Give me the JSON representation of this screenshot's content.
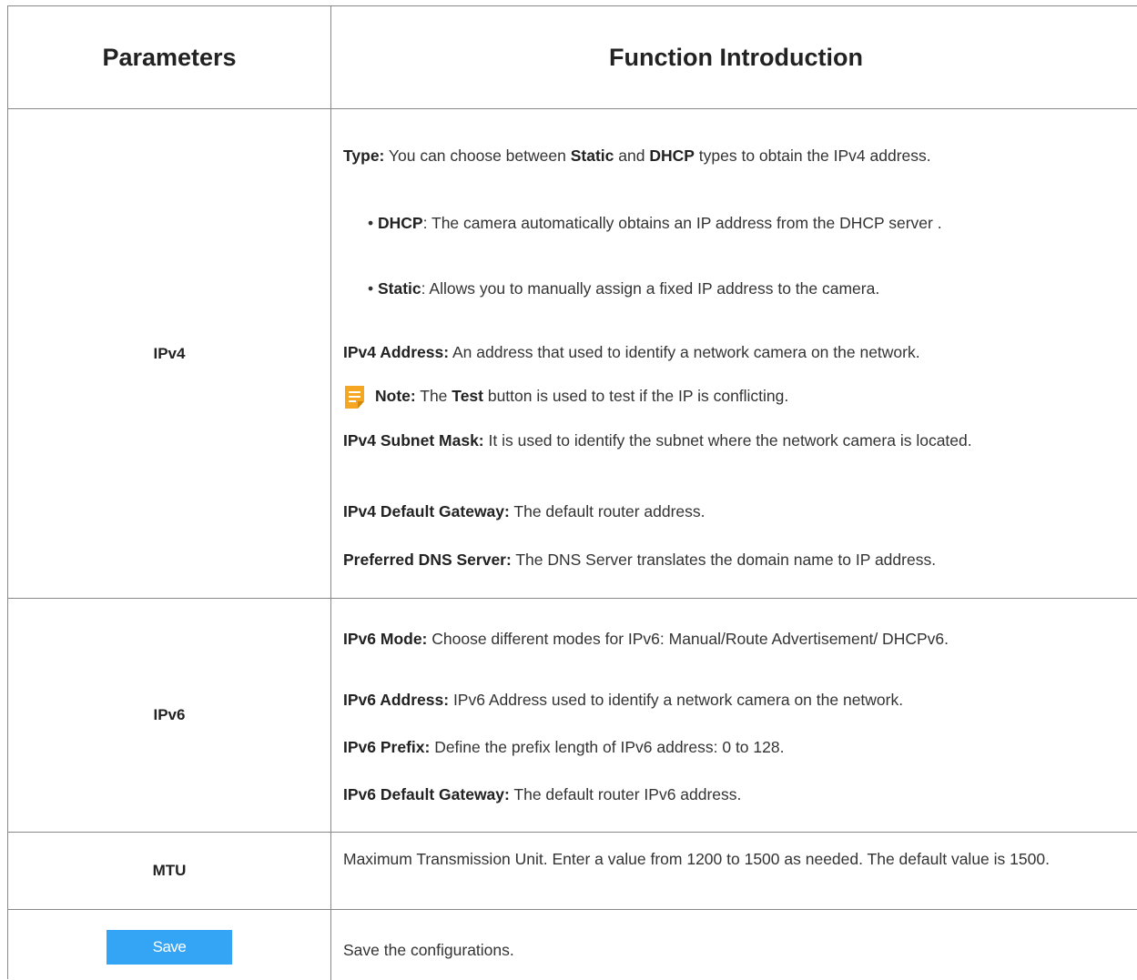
{
  "header": {
    "parameters": "Parameters",
    "function_introduction": "Function Introduction"
  },
  "ipv4": {
    "label": "IPv4",
    "type_label": "Type:",
    "type_text_1": " You can choose between ",
    "type_static": "Static",
    "type_and": " and ",
    "type_dhcp": "DHCP",
    "type_text_2": " types to obtain the IPv4 address.",
    "bullet_dhcp_label": "DHCP",
    "bullet_dhcp_text": ": The camera automatically obtains an IP address from the DHCP server .",
    "bullet_static_label": "Static",
    "bullet_static_text": ": Allows you to manually assign a fixed IP address to the camera.",
    "address_label": "IPv4 Address:",
    "address_text": " An address that used to identify a network camera on the network.",
    "note_label": "Note:",
    "note_text_1": "  The ",
    "note_test": "Test",
    "note_text_2": " button is used to test if the IP is conflicting.",
    "subnet_label": "IPv4 Subnet Mask:",
    "subnet_text": " It is used to identify the subnet where the network camera is located.",
    "gateway_label": "IPv4 Default Gateway:",
    "gateway_text": " The default router address.",
    "dns_label": "Preferred DNS Server:",
    "dns_text": " The DNS Server translates the domain name to IP address."
  },
  "ipv6": {
    "label": "IPv6",
    "mode_label": "IPv6 Mode:",
    "mode_text": " Choose different modes for IPv6: Manual/Route Advertisement/ DHCPv6.",
    "address_label": "IPv6 Address:",
    "address_text": " IPv6 Address used to identify a network camera on the network.",
    "prefix_label": "IPv6 Prefix:",
    "prefix_text": " Define the prefix length of IPv6 address: 0 to 128.",
    "gateway_label": "IPv6 Default Gateway:",
    "gateway_text": " The default router IPv6 address."
  },
  "mtu": {
    "label": "MTU",
    "text": "Maximum Transmission Unit. Enter a value from 1200 to 1500 as needed. The default value is 1500."
  },
  "save": {
    "button_label": "Save",
    "text": "Save the configurations."
  },
  "colors": {
    "save_button": "#34a4f4",
    "note_icon": "#f5a623",
    "border": "#888888"
  }
}
